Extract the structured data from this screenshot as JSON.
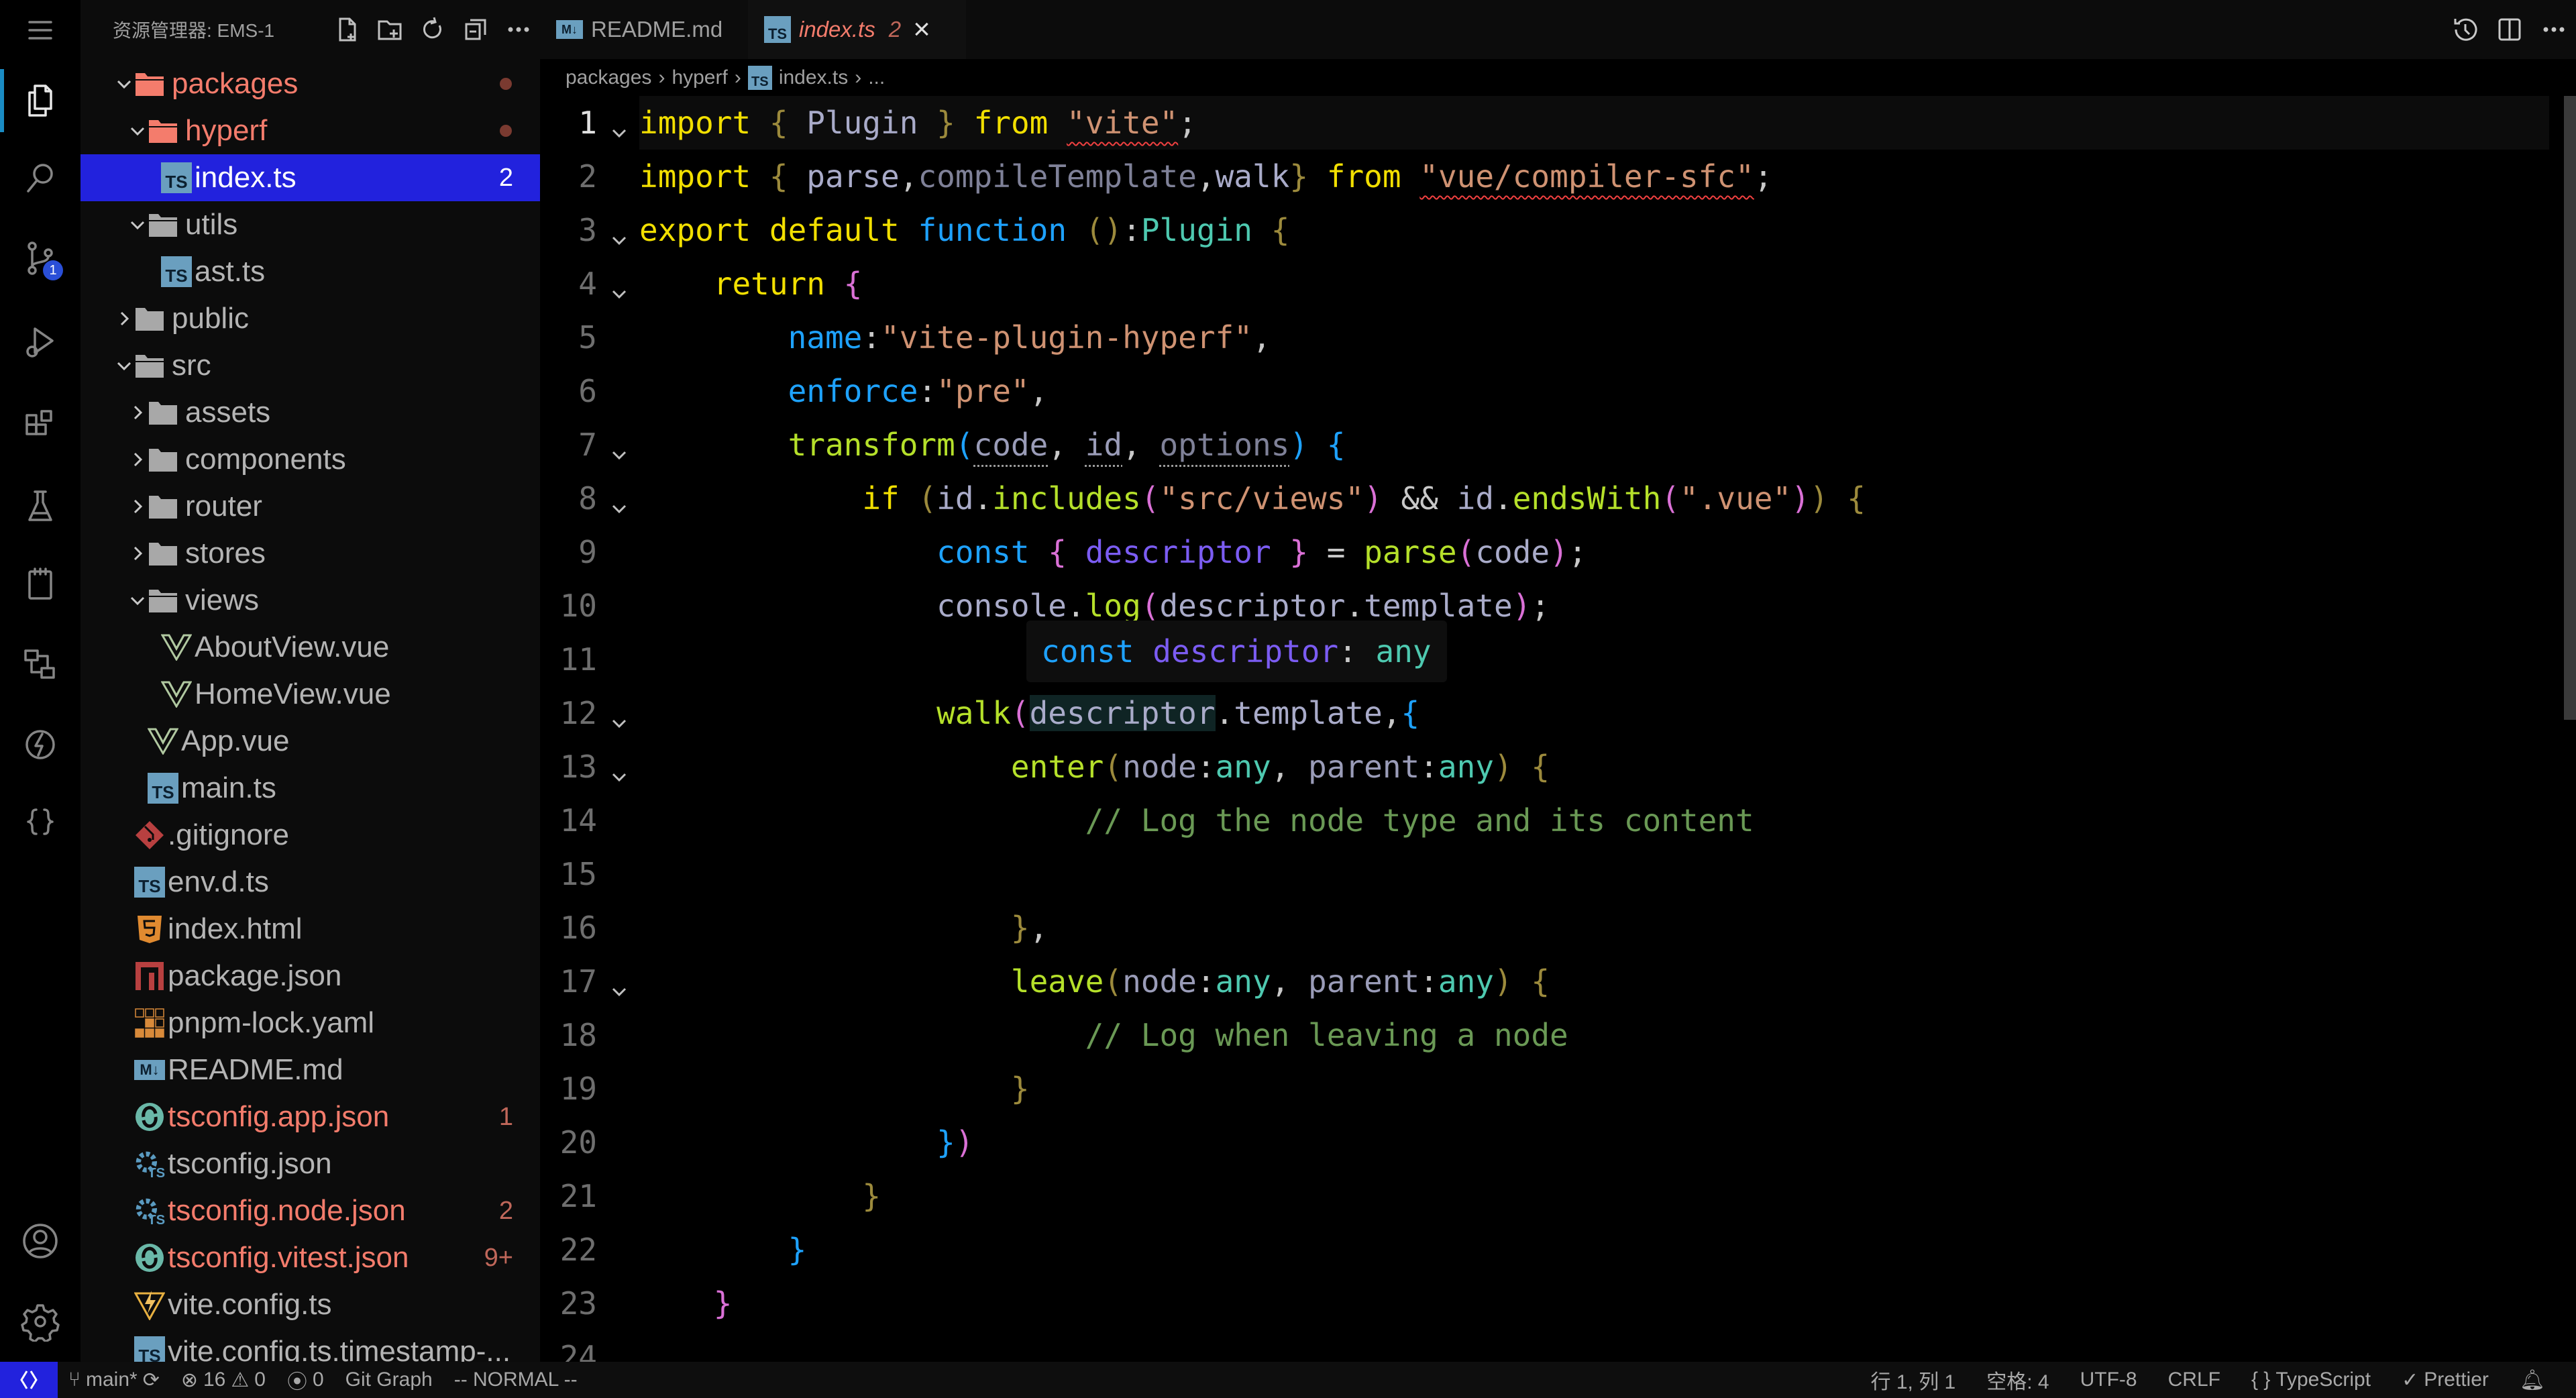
{
  "activity_bar": {
    "items": [
      {
        "name": "menu",
        "icon": "menu-icon"
      },
      {
        "name": "explorer",
        "icon": "files-icon",
        "active": true
      },
      {
        "name": "search",
        "icon": "search-icon"
      },
      {
        "name": "source-control",
        "icon": "source-control-icon",
        "badge": "1"
      },
      {
        "name": "run-debug",
        "icon": "run-debug-icon"
      },
      {
        "name": "extensions",
        "icon": "extensions-icon"
      },
      {
        "name": "testing",
        "icon": "flask-icon"
      },
      {
        "name": "clipboard",
        "icon": "clipboard-icon"
      },
      {
        "name": "remote-explorer",
        "icon": "remote-icon"
      },
      {
        "name": "lightning",
        "icon": "lightning-icon"
      },
      {
        "name": "json",
        "icon": "braces-icon"
      }
    ],
    "bottom": [
      {
        "name": "accounts",
        "icon": "account-icon"
      },
      {
        "name": "settings",
        "icon": "gear-icon"
      }
    ]
  },
  "sidebar": {
    "title": "资源管理器: EMS-1",
    "actions": [
      "new-file-icon",
      "new-folder-icon",
      "refresh-icon",
      "collapse-icon",
      "more-icon"
    ],
    "tree": [
      {
        "label": "packages",
        "depth": 0,
        "type": "folder",
        "open": true,
        "color": "#f47c6c",
        "dot": true
      },
      {
        "label": "hyperf",
        "depth": 1,
        "type": "folder",
        "open": true,
        "color": "#f47c6c",
        "dot": true
      },
      {
        "label": "index.ts",
        "depth": 2,
        "type": "ts",
        "selected": true,
        "badge": "2"
      },
      {
        "label": "utils",
        "depth": 1,
        "type": "folder",
        "open": true
      },
      {
        "label": "ast.ts",
        "depth": 2,
        "type": "ts"
      },
      {
        "label": "public",
        "depth": 0,
        "type": "folder",
        "open": false
      },
      {
        "label": "src",
        "depth": 0,
        "type": "folder",
        "open": true
      },
      {
        "label": "assets",
        "depth": 1,
        "type": "folder",
        "open": false
      },
      {
        "label": "components",
        "depth": 1,
        "type": "folder",
        "open": false
      },
      {
        "label": "router",
        "depth": 1,
        "type": "folder",
        "open": false
      },
      {
        "label": "stores",
        "depth": 1,
        "type": "folder",
        "open": false
      },
      {
        "label": "views",
        "depth": 1,
        "type": "folder",
        "open": true
      },
      {
        "label": "AboutView.vue",
        "depth": 2,
        "type": "vue"
      },
      {
        "label": "HomeView.vue",
        "depth": 2,
        "type": "vue"
      },
      {
        "label": "App.vue",
        "depth": 1,
        "type": "vue"
      },
      {
        "label": "main.ts",
        "depth": 1,
        "type": "ts"
      },
      {
        "label": ".gitignore",
        "depth": 0,
        "type": "git"
      },
      {
        "label": "env.d.ts",
        "depth": 0,
        "type": "ts"
      },
      {
        "label": "index.html",
        "depth": 0,
        "type": "html"
      },
      {
        "label": "package.json",
        "depth": 0,
        "type": "npm"
      },
      {
        "label": "pnpm-lock.yaml",
        "depth": 0,
        "type": "pnpm"
      },
      {
        "label": "README.md",
        "depth": 0,
        "type": "md"
      },
      {
        "label": "tsconfig.app.json",
        "depth": 0,
        "type": "tsconfig-ring",
        "color": "#f47c6c",
        "badge": "1"
      },
      {
        "label": "tsconfig.json",
        "depth": 0,
        "type": "tsconfig-gear"
      },
      {
        "label": "tsconfig.node.json",
        "depth": 0,
        "type": "tsconfig-gear",
        "color": "#f47c6c",
        "badge": "2"
      },
      {
        "label": "tsconfig.vitest.json",
        "depth": 0,
        "type": "tsconfig-ring",
        "color": "#f47c6c",
        "badge": "9+"
      },
      {
        "label": "vite.config.ts",
        "depth": 0,
        "type": "vite"
      },
      {
        "label": "vite.config.ts.timestamp-...",
        "depth": 0,
        "type": "ts"
      }
    ]
  },
  "tabs": [
    {
      "label": "README.md",
      "icon": "markdown-icon",
      "active": false
    },
    {
      "label": "index.ts",
      "icon": "typescript-icon",
      "active": true,
      "badge": "2",
      "close": "×"
    }
  ],
  "icon_text": {
    "ts": "TS",
    "md": "M↓"
  },
  "editor_actions": [
    "timeline-icon",
    "split-editor-icon",
    "more-icon"
  ],
  "breadcrumb": [
    "packages",
    "hyperf",
    "index.ts",
    "..."
  ],
  "editor": {
    "lines": [
      {
        "n": "1",
        "fold": true,
        "cur": true,
        "t": [
          [
            "import",
            "kw"
          ],
          [
            " ",
            "pl"
          ],
          [
            "{",
            "b1"
          ],
          [
            " ",
            "pl"
          ],
          [
            "Plugin",
            "id"
          ],
          [
            " ",
            "pl"
          ],
          [
            "}",
            "b1"
          ],
          [
            " ",
            "pl"
          ],
          [
            "from",
            "kw"
          ],
          [
            " ",
            "pl"
          ],
          [
            "\"vite\"",
            "str sq"
          ],
          [
            ";",
            "pl"
          ]
        ]
      },
      {
        "n": "2",
        "t": [
          [
            "import",
            "kw"
          ],
          [
            " ",
            "pl"
          ],
          [
            "{",
            "b1"
          ],
          [
            " ",
            "pl"
          ],
          [
            "parse",
            "id"
          ],
          [
            ",",
            "pl"
          ],
          [
            "compileTemplate",
            "dim"
          ],
          [
            ",",
            "pl"
          ],
          [
            "walk",
            "id"
          ],
          [
            "}",
            "b1"
          ],
          [
            " ",
            "pl"
          ],
          [
            "from",
            "kw"
          ],
          [
            " ",
            "pl"
          ],
          [
            "\"vue/compiler-sfc\"",
            "str sq"
          ],
          [
            ";",
            "pl"
          ]
        ]
      },
      {
        "n": "3",
        "fold": true,
        "t": [
          [
            "export",
            "kw"
          ],
          [
            " ",
            "pl"
          ],
          [
            "default",
            "kw"
          ],
          [
            " ",
            "pl"
          ],
          [
            "function",
            "bl"
          ],
          [
            " ",
            "pl"
          ],
          [
            "()",
            "b1"
          ],
          [
            ":",
            "pl"
          ],
          [
            "Plugin",
            "ty"
          ],
          [
            " ",
            "pl"
          ],
          [
            "{",
            "b1"
          ]
        ]
      },
      {
        "n": "4",
        "fold": true,
        "t": [
          [
            "    ",
            "pl"
          ],
          [
            "return",
            "kw"
          ],
          [
            " ",
            "pl"
          ],
          [
            "{",
            "pk"
          ]
        ]
      },
      {
        "n": "5",
        "t": [
          [
            "        ",
            "pl"
          ],
          [
            "name",
            "bl"
          ],
          [
            ":",
            "pl"
          ],
          [
            "\"vite-plugin-hyperf\"",
            "str"
          ],
          [
            ",",
            "pl"
          ]
        ]
      },
      {
        "n": "6",
        "t": [
          [
            "        ",
            "pl"
          ],
          [
            "enforce",
            "bl"
          ],
          [
            ":",
            "pl"
          ],
          [
            "\"pre\"",
            "str"
          ],
          [
            ",",
            "pl"
          ]
        ]
      },
      {
        "n": "7",
        "fold": true,
        "t": [
          [
            "        ",
            "pl"
          ],
          [
            "transform",
            "fn"
          ],
          [
            "(",
            "bl"
          ],
          [
            "code",
            "prm dt"
          ],
          [
            ", ",
            "pl"
          ],
          [
            "id",
            "prm dt"
          ],
          [
            ", ",
            "pl"
          ],
          [
            "options",
            "dim dt"
          ],
          [
            ")",
            "bl"
          ],
          [
            " ",
            "pl"
          ],
          [
            "{",
            "bl"
          ]
        ]
      },
      {
        "n": "8",
        "fold": true,
        "t": [
          [
            "            ",
            "pl"
          ],
          [
            "if",
            "kw"
          ],
          [
            " ",
            "pl"
          ],
          [
            "(",
            "b1"
          ],
          [
            "id",
            "id"
          ],
          [
            ".",
            "pl"
          ],
          [
            "includes",
            "fn"
          ],
          [
            "(",
            "pk"
          ],
          [
            "\"src/views\"",
            "str"
          ],
          [
            ")",
            "pk"
          ],
          [
            " && ",
            "pl"
          ],
          [
            "id",
            "id"
          ],
          [
            ".",
            "pl"
          ],
          [
            "endsWith",
            "fn"
          ],
          [
            "(",
            "pk"
          ],
          [
            "\".vue\"",
            "str"
          ],
          [
            ")",
            "pk"
          ],
          [
            ")",
            "b1"
          ],
          [
            " ",
            "pl"
          ],
          [
            "{",
            "b1"
          ]
        ]
      },
      {
        "n": "9",
        "t": [
          [
            "                ",
            "pl"
          ],
          [
            "const",
            "bl"
          ],
          [
            " ",
            "pl"
          ],
          [
            "{",
            "pk"
          ],
          [
            " ",
            "pl"
          ],
          [
            "descriptor",
            "pu"
          ],
          [
            " ",
            "pl"
          ],
          [
            "}",
            "pk"
          ],
          [
            " = ",
            "pl"
          ],
          [
            "parse",
            "fn"
          ],
          [
            "(",
            "pk"
          ],
          [
            "code",
            "id"
          ],
          [
            ")",
            "pk"
          ],
          [
            ";",
            "pl"
          ]
        ]
      },
      {
        "n": "10",
        "t": [
          [
            "                ",
            "pl"
          ],
          [
            "console",
            "id"
          ],
          [
            ".",
            "pl"
          ],
          [
            "log",
            "fn"
          ],
          [
            "(",
            "pk"
          ],
          [
            "descriptor",
            "id"
          ],
          [
            ".",
            "pl"
          ],
          [
            "template",
            "id"
          ],
          [
            ")",
            "pk"
          ],
          [
            ";",
            "pl"
          ]
        ]
      },
      {
        "n": "11",
        "t": []
      },
      {
        "n": "12",
        "fold": true,
        "t": [
          [
            "                ",
            "pl"
          ],
          [
            "walk",
            "fn"
          ],
          [
            "(",
            "pk"
          ],
          [
            "descriptor",
            "id hl"
          ],
          [
            ".",
            "pl"
          ],
          [
            "template",
            "id"
          ],
          [
            ",",
            "pl"
          ],
          [
            "{",
            "bl"
          ]
        ]
      },
      {
        "n": "13",
        "fold": true,
        "t": [
          [
            "                    ",
            "pl"
          ],
          [
            "enter",
            "fn"
          ],
          [
            "(",
            "b1"
          ],
          [
            "node",
            "prm"
          ],
          [
            ":",
            "pl"
          ],
          [
            "any",
            "ty"
          ],
          [
            ", ",
            "pl"
          ],
          [
            "parent",
            "prm"
          ],
          [
            ":",
            "pl"
          ],
          [
            "any",
            "ty"
          ],
          [
            ")",
            "b1"
          ],
          [
            " ",
            "pl"
          ],
          [
            "{",
            "b1"
          ]
        ]
      },
      {
        "n": "14",
        "t": [
          [
            "                        ",
            "pl"
          ],
          [
            "// Log the node type and its content",
            "cm"
          ]
        ]
      },
      {
        "n": "15",
        "t": []
      },
      {
        "n": "16",
        "t": [
          [
            "                    ",
            "pl"
          ],
          [
            "}",
            "b1"
          ],
          [
            ",",
            "pl"
          ]
        ]
      },
      {
        "n": "17",
        "fold": true,
        "t": [
          [
            "                    ",
            "pl"
          ],
          [
            "leave",
            "fn"
          ],
          [
            "(",
            "b1"
          ],
          [
            "node",
            "prm"
          ],
          [
            ":",
            "pl"
          ],
          [
            "any",
            "ty"
          ],
          [
            ", ",
            "pl"
          ],
          [
            "parent",
            "prm"
          ],
          [
            ":",
            "pl"
          ],
          [
            "any",
            "ty"
          ],
          [
            ")",
            "b1"
          ],
          [
            " ",
            "pl"
          ],
          [
            "{",
            "b1"
          ]
        ]
      },
      {
        "n": "18",
        "t": [
          [
            "                        ",
            "pl"
          ],
          [
            "// Log when leaving a node",
            "cm"
          ]
        ]
      },
      {
        "n": "19",
        "t": [
          [
            "                    ",
            "pl"
          ],
          [
            "}",
            "b1"
          ]
        ]
      },
      {
        "n": "20",
        "t": [
          [
            "                ",
            "pl"
          ],
          [
            "}",
            "bl"
          ],
          [
            ")",
            "pk"
          ]
        ]
      },
      {
        "n": "21",
        "t": [
          [
            "            ",
            "pl"
          ],
          [
            "}",
            "b1"
          ]
        ]
      },
      {
        "n": "22",
        "t": [
          [
            "        ",
            "pl"
          ],
          [
            "}",
            "bl"
          ]
        ]
      },
      {
        "n": "23",
        "t": [
          [
            "    ",
            "pl"
          ],
          [
            "}",
            "pk"
          ]
        ]
      },
      {
        "n": "24",
        "t": []
      }
    ],
    "hover": {
      "kw": "const",
      "name": "descriptor",
      "sep": ": ",
      "type": "any"
    }
  },
  "status": {
    "branch": "main*",
    "errors": "16",
    "warnings": "0",
    "ports": "0",
    "git_graph": "Git Graph",
    "mode": "-- NORMAL --",
    "position": "行 1, 列 1",
    "spaces": "空格: 4",
    "encoding": "UTF-8",
    "eol": "CRLF",
    "language": "TypeScript",
    "prettier": "Prettier"
  },
  "colors": {
    "accent": "#2222dd",
    "selection": "#2222dd",
    "modified": "#f47c6c",
    "badge": "#c0675a"
  }
}
